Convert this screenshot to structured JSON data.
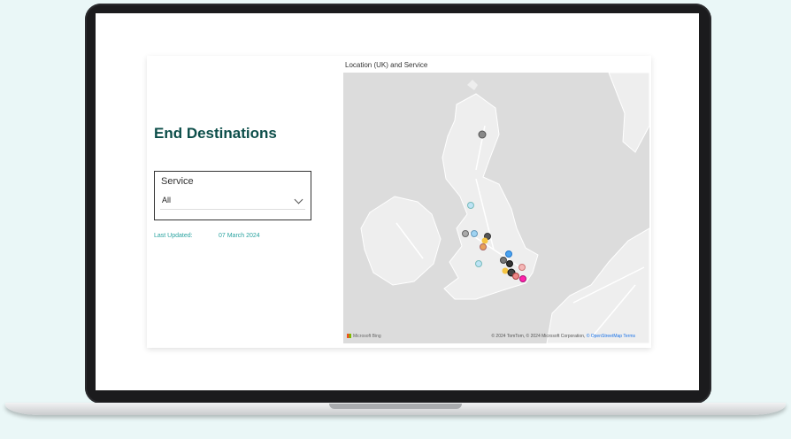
{
  "report": {
    "title": "End Destinations",
    "slicer": {
      "label": "Service",
      "value": "All"
    },
    "last_updated_label": "Last Updated:",
    "last_updated_value": "07 March 2024"
  },
  "map": {
    "title": "Location (UK) and Service",
    "provider": "Microsoft Bing",
    "attribution": "© 2024 TomTom, © 2024 Microsoft Corporation, ",
    "osm_link": "© OpenStreetMap",
    "terms_link": "Terms",
    "colors": {
      "sea": "#dcdcdc",
      "land": "#eeeeee"
    }
  }
}
